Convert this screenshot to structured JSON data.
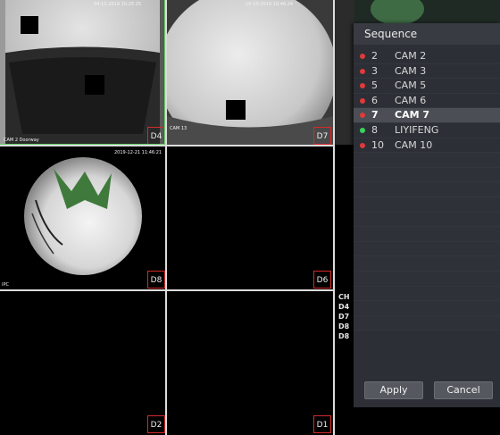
{
  "cameras": {
    "top_left": {
      "label": "D4",
      "osd_time": "04-11-2019 10:25:15",
      "osd_name": "CAM 2 Doorway"
    },
    "top_mid": {
      "label": "D7",
      "osd_time": "10-10-2019 10:46:24",
      "osd_name": "CAM 13"
    },
    "mid_left": {
      "label": "D8",
      "osd_time": "2019-12-21 11:46:21",
      "osd_name": "IPC"
    },
    "mid_mid": {
      "label": "D6"
    },
    "bot_left": {
      "label": "D2"
    },
    "bot_mid": {
      "label": "D1"
    }
  },
  "channel_list": {
    "header": "CH",
    "items": [
      "D4",
      "D7",
      "D8",
      "D8"
    ]
  },
  "sequence_panel": {
    "title": "Sequence",
    "items": [
      {
        "num": "2",
        "name": "CAM 2",
        "status_color": "#e03a3a",
        "selected": false
      },
      {
        "num": "3",
        "name": "CAM 3",
        "status_color": "#e03a3a",
        "selected": false
      },
      {
        "num": "5",
        "name": "CAM 5",
        "status_color": "#e03a3a",
        "selected": false
      },
      {
        "num": "6",
        "name": "CAM 6",
        "status_color": "#e03a3a",
        "selected": false
      },
      {
        "num": "7",
        "name": "CAM 7",
        "status_color": "#e03a3a",
        "selected": true
      },
      {
        "num": "8",
        "name": "LIYIFENG",
        "status_color": "#3bd35a",
        "selected": false
      },
      {
        "num": "10",
        "name": "CAM 10",
        "status_color": "#e03a3a",
        "selected": false
      }
    ],
    "apply_label": "Apply",
    "cancel_label": "Cancel"
  }
}
